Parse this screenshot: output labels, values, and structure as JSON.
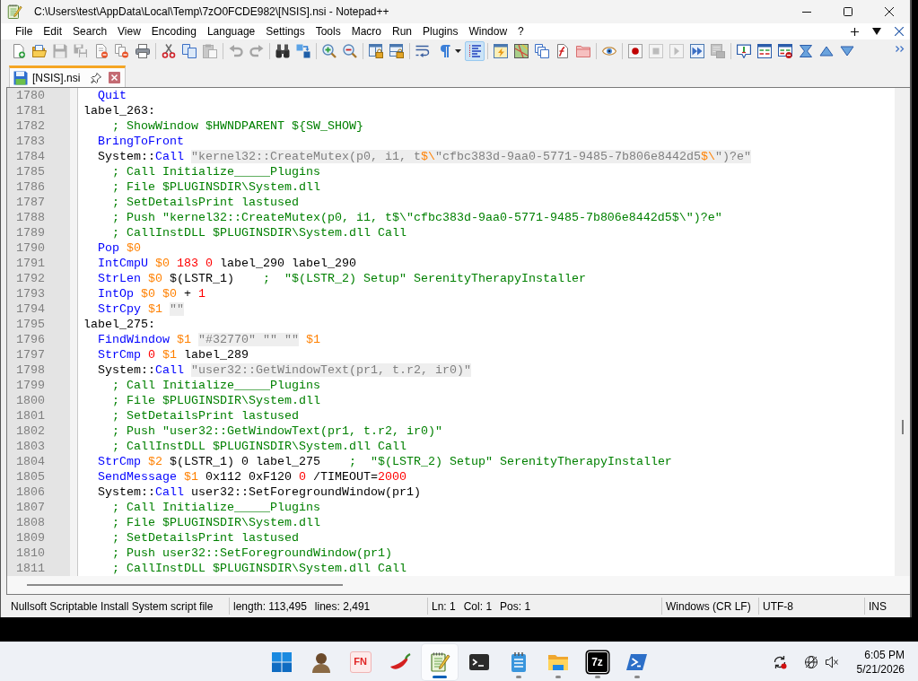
{
  "window": {
    "title": "C:\\Users\\test\\AppData\\Local\\Temp\\7zO0FCDE982\\[NSIS].nsi - Notepad++"
  },
  "menu": [
    "File",
    "Edit",
    "Search",
    "View",
    "Encoding",
    "Language",
    "Settings",
    "Tools",
    "Macro",
    "Run",
    "Plugins",
    "Window",
    "?"
  ],
  "toolbar": {
    "groups": [
      {
        "items": [
          {
            "kind": "new",
            "disabled": false,
            "selected": false
          },
          {
            "kind": "open",
            "disabled": false,
            "selected": false
          },
          {
            "kind": "save",
            "disabled": true,
            "selected": false
          },
          {
            "kind": "save-all",
            "disabled": true,
            "selected": false
          },
          {
            "kind": "close",
            "disabled": false,
            "selected": false
          },
          {
            "kind": "close-all",
            "disabled": false,
            "selected": false
          },
          {
            "kind": "print",
            "disabled": false,
            "selected": false
          }
        ]
      },
      {
        "items": [
          {
            "kind": "cut",
            "disabled": false,
            "selected": false
          },
          {
            "kind": "copy",
            "disabled": false,
            "selected": false
          },
          {
            "kind": "paste",
            "disabled": true,
            "selected": false
          }
        ]
      },
      {
        "items": [
          {
            "kind": "undo",
            "disabled": true,
            "selected": false
          },
          {
            "kind": "redo",
            "disabled": true,
            "selected": false
          }
        ]
      },
      {
        "items": [
          {
            "kind": "find",
            "disabled": false,
            "selected": false
          },
          {
            "kind": "replace",
            "disabled": false,
            "selected": false
          }
        ]
      },
      {
        "items": [
          {
            "kind": "zoom-in",
            "disabled": false,
            "selected": false
          },
          {
            "kind": "zoom-out",
            "disabled": false,
            "selected": false
          }
        ]
      },
      {
        "items": [
          {
            "kind": "sync-v",
            "disabled": false,
            "selected": false
          },
          {
            "kind": "sync-h",
            "disabled": false,
            "selected": false
          }
        ]
      },
      {
        "items": [
          {
            "kind": "wrap",
            "disabled": false,
            "selected": false
          },
          {
            "kind": "all-chars",
            "disabled": false,
            "selected": false
          },
          {
            "kind": "indent-guide",
            "disabled": false,
            "selected": true
          }
        ]
      },
      {
        "items": [
          {
            "kind": "udl",
            "disabled": false,
            "selected": false
          },
          {
            "kind": "doc-map",
            "disabled": false,
            "selected": false
          },
          {
            "kind": "doc-list",
            "disabled": false,
            "selected": false
          },
          {
            "kind": "function-list",
            "disabled": false,
            "selected": false
          },
          {
            "kind": "folder-workspace",
            "disabled": false,
            "selected": false
          }
        ]
      },
      {
        "items": [
          {
            "kind": "monitor",
            "disabled": false,
            "selected": false
          }
        ]
      },
      {
        "items": [
          {
            "kind": "record",
            "disabled": false,
            "selected": false
          },
          {
            "kind": "stop",
            "disabled": true,
            "selected": false
          },
          {
            "kind": "play",
            "disabled": true,
            "selected": false
          },
          {
            "kind": "play-multi",
            "disabled": false,
            "selected": false
          },
          {
            "kind": "save-macro",
            "disabled": true,
            "selected": false
          }
        ]
      },
      {
        "items": [
          {
            "kind": "bubble",
            "disabled": false,
            "selected": false
          },
          {
            "kind": "list",
            "disabled": false,
            "selected": false
          },
          {
            "kind": "list-minus",
            "disabled": false,
            "selected": false
          },
          {
            "kind": "hourglass",
            "disabled": false,
            "selected": false
          },
          {
            "kind": "up",
            "disabled": false,
            "selected": false
          },
          {
            "kind": "down",
            "disabled": false,
            "selected": false
          }
        ]
      }
    ]
  },
  "tabs": [
    {
      "label": "[NSIS].nsi",
      "selected": true
    }
  ],
  "editor": {
    "lines": [
      {
        "number": "1780",
        "tokens": [
          {
            "kind": "keyword",
            "text": "  Quit"
          }
        ]
      },
      {
        "number": "1781",
        "tokens": [
          {
            "kind": "plain",
            "text": "label_263:"
          }
        ]
      },
      {
        "number": "1782",
        "tokens": [
          {
            "kind": "comment",
            "text": "    ; ShowWindow $HWNDPARENT ${SW_SHOW}"
          }
        ]
      },
      {
        "number": "1783",
        "tokens": [
          {
            "kind": "keyword",
            "text": "  BringToFront"
          }
        ]
      },
      {
        "number": "1784",
        "tokens": [
          {
            "kind": "plain",
            "text": "  System::"
          },
          {
            "kind": "keyword",
            "text": "Call "
          },
          {
            "kind": "string",
            "text": "\"kernel32::CreateMutex(p0, i1, t"
          },
          {
            "kind": "string_variable",
            "text": "$\\"
          },
          {
            "kind": "string",
            "text": "\"cfbc383d-9aa0-5771-9485-7b806e8442d5"
          },
          {
            "kind": "string_variable",
            "text": "$\\"
          },
          {
            "kind": "string",
            "text": "\")?e\""
          }
        ]
      },
      {
        "number": "1785",
        "tokens": [
          {
            "kind": "comment",
            "text": "    ; Call Initialize_____Plugins"
          }
        ]
      },
      {
        "number": "1786",
        "tokens": [
          {
            "kind": "comment",
            "text": "    ; File $PLUGINSDIR\\System.dll"
          }
        ]
      },
      {
        "number": "1787",
        "tokens": [
          {
            "kind": "comment",
            "text": "    ; SetDetailsPrint lastused"
          }
        ]
      },
      {
        "number": "1788",
        "tokens": [
          {
            "kind": "comment",
            "text": "    ; Push \"kernel32::CreateMutex(p0, i1, t$\\\"cfbc383d-9aa0-5771-9485-7b806e8442d5$\\\")?e\""
          }
        ]
      },
      {
        "number": "1789",
        "tokens": [
          {
            "kind": "comment",
            "text": "    ; CallInstDLL $PLUGINSDIR\\System.dll Call"
          }
        ]
      },
      {
        "number": "1790",
        "tokens": [
          {
            "kind": "keyword",
            "text": "  Pop "
          },
          {
            "kind": "variable",
            "text": "$0"
          }
        ]
      },
      {
        "number": "1791",
        "tokens": [
          {
            "kind": "keyword",
            "text": "  IntCmpU "
          },
          {
            "kind": "variable",
            "text": "$0 "
          },
          {
            "kind": "number",
            "text": "183 "
          },
          {
            "kind": "number",
            "text": "0"
          },
          {
            "kind": "plain",
            "text": " label_290 label_290"
          }
        ]
      },
      {
        "number": "1792",
        "tokens": [
          {
            "kind": "keyword",
            "text": "  StrLen "
          },
          {
            "kind": "variable",
            "text": "$0"
          },
          {
            "kind": "plain",
            "text": " $(LSTR_1)    "
          },
          {
            "kind": "comment",
            "text": ";  \"$(LSTR_2) Setup\" SerenityTherapyInstaller"
          }
        ]
      },
      {
        "number": "1793",
        "tokens": [
          {
            "kind": "keyword",
            "text": "  IntOp "
          },
          {
            "kind": "variable",
            "text": "$0 "
          },
          {
            "kind": "variable",
            "text": "$0"
          },
          {
            "kind": "plain",
            "text": " + "
          },
          {
            "kind": "number",
            "text": "1"
          }
        ]
      },
      {
        "number": "1794",
        "tokens": [
          {
            "kind": "keyword",
            "text": "  StrCpy "
          },
          {
            "kind": "variable",
            "text": "$1 "
          },
          {
            "kind": "string",
            "text": "\"\""
          }
        ]
      },
      {
        "number": "1795",
        "tokens": [
          {
            "kind": "plain",
            "text": "label_275:"
          }
        ]
      },
      {
        "number": "1796",
        "tokens": [
          {
            "kind": "keyword",
            "text": "  FindWindow "
          },
          {
            "kind": "variable",
            "text": "$1 "
          },
          {
            "kind": "string",
            "text": "\"#32770\" \"\" \"\""
          },
          {
            "kind": "variable",
            "text": " $1"
          }
        ]
      },
      {
        "number": "1797",
        "tokens": [
          {
            "kind": "keyword",
            "text": "  StrCmp "
          },
          {
            "kind": "number",
            "text": "0 "
          },
          {
            "kind": "variable",
            "text": "$1"
          },
          {
            "kind": "plain",
            "text": " label_289"
          }
        ]
      },
      {
        "number": "1798",
        "tokens": [
          {
            "kind": "plain",
            "text": "  System::"
          },
          {
            "kind": "keyword",
            "text": "Call "
          },
          {
            "kind": "string",
            "text": "\"user32::GetWindowText(pr1, t.r2, ir0)\""
          }
        ]
      },
      {
        "number": "1799",
        "tokens": [
          {
            "kind": "comment",
            "text": "    ; Call Initialize_____Plugins"
          }
        ]
      },
      {
        "number": "1800",
        "tokens": [
          {
            "kind": "comment",
            "text": "    ; File $PLUGINSDIR\\System.dll"
          }
        ]
      },
      {
        "number": "1801",
        "tokens": [
          {
            "kind": "comment",
            "text": "    ; SetDetailsPrint lastused"
          }
        ]
      },
      {
        "number": "1802",
        "tokens": [
          {
            "kind": "comment",
            "text": "    ; Push \"user32::GetWindowText(pr1, t.r2, ir0)\""
          }
        ]
      },
      {
        "number": "1803",
        "tokens": [
          {
            "kind": "comment",
            "text": "    ; CallInstDLL $PLUGINSDIR\\System.dll Call"
          }
        ]
      },
      {
        "number": "1804",
        "tokens": [
          {
            "kind": "keyword",
            "text": "  StrCmp "
          },
          {
            "kind": "variable",
            "text": "$2"
          },
          {
            "kind": "plain",
            "text": " $(LSTR_1) 0 label_275    "
          },
          {
            "kind": "comment",
            "text": ";  \"$(LSTR_2) Setup\" SerenityTherapyInstaller"
          }
        ]
      },
      {
        "number": "1805",
        "tokens": [
          {
            "kind": "keyword",
            "text": "  SendMessage "
          },
          {
            "kind": "variable",
            "text": "$1"
          },
          {
            "kind": "plain",
            "text": " 0x112 0xF120 "
          },
          {
            "kind": "number",
            "text": "0"
          },
          {
            "kind": "plain",
            "text": " /TIMEOUT="
          },
          {
            "kind": "number",
            "text": "2000"
          }
        ]
      },
      {
        "number": "1806",
        "tokens": [
          {
            "kind": "plain",
            "text": "  System::"
          },
          {
            "kind": "keyword",
            "text": "Call"
          },
          {
            "kind": "plain",
            "text": " user32::SetForegroundWindow(pr1)"
          }
        ]
      },
      {
        "number": "1807",
        "tokens": [
          {
            "kind": "comment",
            "text": "    ; Call Initialize_____Plugins"
          }
        ]
      },
      {
        "number": "1808",
        "tokens": [
          {
            "kind": "comment",
            "text": "    ; File $PLUGINSDIR\\System.dll"
          }
        ]
      },
      {
        "number": "1809",
        "tokens": [
          {
            "kind": "comment",
            "text": "    ; SetDetailsPrint lastused"
          }
        ]
      },
      {
        "number": "1810",
        "tokens": [
          {
            "kind": "comment",
            "text": "    ; Push user32::SetForegroundWindow(pr1)"
          }
        ]
      },
      {
        "number": "1811",
        "tokens": [
          {
            "kind": "comment",
            "text": "    ; CallInstDLL $PLUGINSDIR\\System.dll Call"
          }
        ]
      }
    ]
  },
  "status_bar": [
    {
      "texts": [
        "Nullsoft Scriptable Install System script file"
      ]
    },
    {
      "texts": [
        "length: 113,495",
        "lines: 2,491"
      ]
    },
    {
      "texts": [
        "Ln: 1",
        "Col: 1",
        "Pos: 1"
      ]
    },
    {
      "texts": [
        "Windows (CR LF)"
      ]
    },
    {
      "texts": [
        "UTF-8"
      ]
    },
    {
      "texts": [
        "INS"
      ]
    }
  ],
  "taskbar": {
    "apps": [
      {
        "kind": "start",
        "running": false,
        "selected": false
      },
      {
        "kind": "portrait",
        "running": false,
        "selected": false
      },
      {
        "kind": "tile-light",
        "label": "FN",
        "running": false,
        "selected": false
      },
      {
        "kind": "pepper",
        "running": false,
        "selected": false
      },
      {
        "kind": "notepad-pen",
        "running": true,
        "selected": true
      },
      {
        "kind": "terminal",
        "running": false,
        "selected": false
      },
      {
        "kind": "notepad",
        "running": true,
        "selected": false
      },
      {
        "kind": "explorer",
        "running": true,
        "selected": false
      },
      {
        "kind": "tile-dark",
        "label": "7z",
        "running": true,
        "selected": false
      },
      {
        "kind": "prompt",
        "running": true,
        "selected": false
      }
    ],
    "clock": {
      "time": "6:05 PM",
      "date": "5/21/2026"
    }
  }
}
